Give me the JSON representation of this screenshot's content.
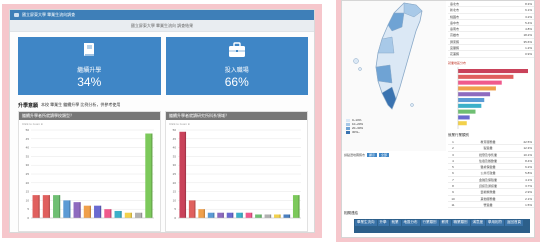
{
  "left": {
    "titlebar": "國立屏東大學 畢業生流向調查",
    "subtitle": "國立屏東大學 畢業生流向 調查結果",
    "tiles": [
      {
        "icon": "book-icon",
        "label": "繼續升學",
        "value": "34%"
      },
      {
        "icon": "briefcase-icon",
        "label": "投入職場",
        "value": "66%"
      }
    ],
    "analysis": {
      "heading": "升學意願",
      "text": "本校 畢業生 繼續升學 比例分析，供參考使用"
    },
    "charts": [
      {
        "title": "繼續升學者所就讀學校類型？",
        "subtitle": "Click to zoom in",
        "chart_data": {
          "type": "bar",
          "categories": [
            "1",
            "2",
            "3",
            "4",
            "5",
            "6",
            "7",
            "8",
            "9",
            "10",
            "11",
            "12"
          ],
          "values": [
            13,
            13,
            13,
            10,
            9,
            7,
            7,
            5,
            4,
            3,
            3,
            48
          ],
          "colors": [
            "#e0605e",
            "#e0605e",
            "#6fbf73",
            "#5b9bd5",
            "#8e6bbf",
            "#f0a04b",
            "#6a6ad0",
            "#f05a8c",
            "#3cb0c9",
            "#f2d14b",
            "#b0b0b0",
            "#7cc95b"
          ],
          "ylim": [
            0,
            50
          ]
        }
      },
      {
        "title": "繼續升學者就讀研究所科系領域？",
        "subtitle": "Click to zoom in",
        "chart_data": {
          "type": "bar",
          "categories": [
            "1",
            "2",
            "3",
            "4",
            "5",
            "6",
            "7",
            "8",
            "9",
            "10",
            "11",
            "12",
            "13"
          ],
          "values": [
            49,
            10,
            5,
            3,
            3,
            3,
            3,
            3,
            2,
            2,
            2,
            2,
            13
          ],
          "colors": [
            "#c9425a",
            "#e0605e",
            "#f0a04b",
            "#5b9bd5",
            "#8e6bbf",
            "#6a6ad0",
            "#3cb0c9",
            "#f05a8c",
            "#6fbf73",
            "#b0b0b0",
            "#f2d14b",
            "#4a7fc0",
            "#7cc95b"
          ],
          "ylim": [
            0,
            50
          ]
        }
      }
    ]
  },
  "right": {
    "map_legend": [
      "0~10%",
      "10~20%",
      "20~30%",
      "30%~"
    ],
    "map_legend_colors": [
      "#dbe8f5",
      "#a8c9e8",
      "#6fa3d4",
      "#3a73b0"
    ],
    "map_note": "請點選地圖縣市",
    "map_buttons": [
      "顯示",
      "全部"
    ],
    "table1": [
      [
        "臺北市",
        "",
        "8.3%"
      ],
      [
        "新北市",
        "",
        "6.1%"
      ],
      [
        "桃園市",
        "",
        "3.2%"
      ],
      [
        "臺中市",
        "",
        "5.4%"
      ],
      [
        "臺南市",
        "",
        "4.8%"
      ],
      [
        "高雄市",
        "",
        "18.2%"
      ],
      [
        "屏東縣",
        "",
        "35.6%"
      ],
      [
        "宜蘭縣",
        "",
        "1.2%"
      ],
      [
        "花蓮縣",
        "",
        "0.9%"
      ]
    ],
    "bar_title": "就業地區分布",
    "bar_chart": {
      "type": "bar",
      "orientation": "horizontal",
      "values": [
        48,
        38,
        30,
        26,
        22,
        18,
        16,
        12,
        8,
        6
      ],
      "colors": [
        "#c9425a",
        "#e0605e",
        "#f05a8c",
        "#f0a04b",
        "#8e6bbf",
        "#5b9bd5",
        "#3cb0c9",
        "#6fbf73",
        "#6a6ad0",
        "#f2d14b"
      ]
    },
    "sec_title": "就業行業類別",
    "table2": [
      [
        "1",
        "教育服務業",
        "22.5%"
      ],
      [
        "2",
        "製造業",
        "12.3%"
      ],
      [
        "3",
        "批發及零售業",
        "10.1%"
      ],
      [
        "4",
        "住宿及餐飲業",
        "8.4%"
      ],
      [
        "5",
        "醫療保健業",
        "6.2%"
      ],
      [
        "6",
        "公共行政業",
        "5.8%"
      ],
      [
        "7",
        "金融及保險業",
        "4.1%"
      ],
      [
        "8",
        "資訊及通訊業",
        "3.7%"
      ],
      [
        "9",
        "藝術娛樂業",
        "2.9%"
      ],
      [
        "10",
        "其他服務業",
        "2.1%"
      ],
      [
        "11",
        "營造業",
        "1.5%"
      ]
    ],
    "bottom_label": "相關連結",
    "nav": [
      "畢業生流向",
      "升學",
      "就業",
      "地區分布",
      "行業類別",
      "薪資",
      "職業類別",
      "滿意度",
      "學用相符",
      "返回首頁"
    ]
  }
}
